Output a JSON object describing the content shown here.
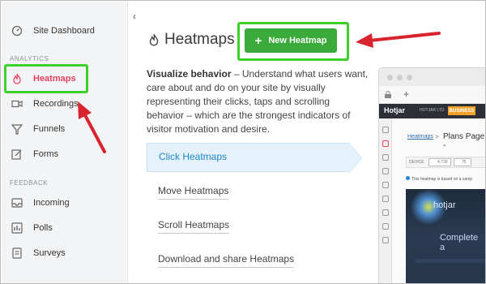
{
  "sidebar": {
    "collapse_glyph": "‹",
    "top_item": {
      "label": "Site Dashboard",
      "icon": "speedometer-icon"
    },
    "sections": {
      "analytics": "ANALYTICS",
      "feedback": "FEEDBACK"
    },
    "analytics_items": [
      {
        "label": "Heatmaps",
        "icon": "flame-icon",
        "active": true
      },
      {
        "label": "Recordings",
        "icon": "video-camera-icon"
      },
      {
        "label": "Funnels",
        "icon": "funnel-icon"
      },
      {
        "label": "Forms",
        "icon": "form-edit-icon"
      }
    ],
    "feedback_items": [
      {
        "label": "Incoming",
        "icon": "inbox-icon"
      },
      {
        "label": "Polls",
        "icon": "poll-icon"
      },
      {
        "label": "Surveys",
        "icon": "survey-icon"
      }
    ]
  },
  "main": {
    "title": "Heatmaps",
    "new_button_label": "New Heatmap",
    "new_button_plus": "+",
    "description_bold": "Visualize behavior",
    "description_rest": " – Understand what users want, care about and do on your site by visually representing their clicks, taps and scrolling behavior – which are the strongest indicators of visitor motivation and desire.",
    "tabs": [
      {
        "label": "Click Heatmaps",
        "active": true
      },
      {
        "label": "Move Heatmaps"
      },
      {
        "label": "Scroll Heatmaps"
      },
      {
        "label": "Download and share Heatmaps"
      }
    ]
  },
  "preview": {
    "tab_glyph": "+",
    "logo": "Hotjar",
    "company": "HOTJAR LTD",
    "plan_badge": "BUSINESS",
    "breadcrumb": "Heatmaps",
    "breadcrumb_sep": ">",
    "page_title": "Plans Page -",
    "device_label": "DEVICE",
    "desktop_count": "4,730",
    "tablet_count": "75",
    "note": "This heatmap is based on a samp",
    "heat_text_1": "hotjar",
    "heat_text_2": "Complete a"
  },
  "colors": {
    "highlight": "#3ed02b",
    "arrow": "#d9232e",
    "active_nav": "#e8445f",
    "button_green": "#3aaa3a",
    "tab_blue": "#1f87c9",
    "sidebar_bg": "#f3f4f6",
    "plan_badge": "#f2a22c"
  }
}
